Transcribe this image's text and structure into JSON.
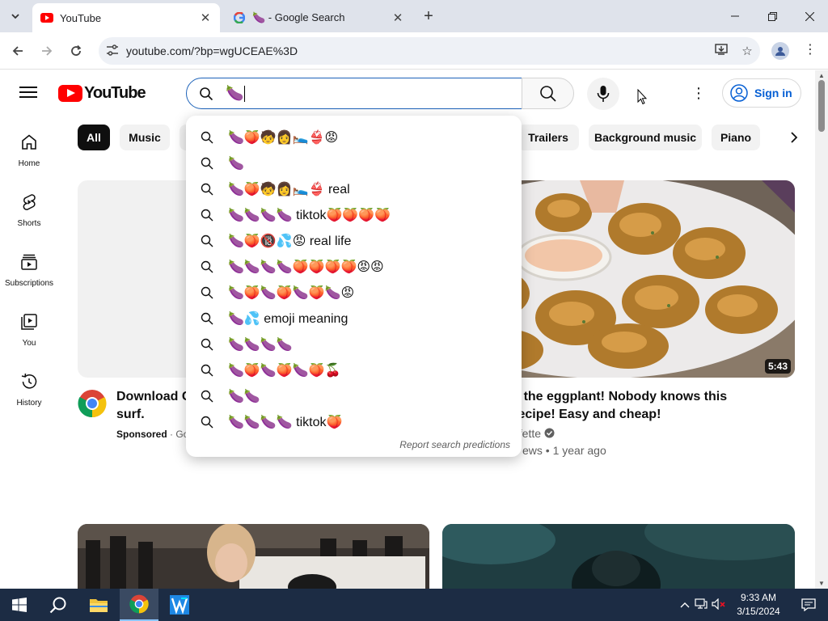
{
  "browser": {
    "tabs": [
      {
        "title": "YouTube",
        "active": true
      },
      {
        "title": "🍆 - Google Search",
        "active": false
      }
    ],
    "url": "youtube.com/?bp=wgUCEAE%3D"
  },
  "header": {
    "logo_text": "YouTube",
    "search_value": "🍆",
    "signin_label": "Sign in"
  },
  "guide": [
    {
      "label": "Home",
      "icon": "home-icon"
    },
    {
      "label": "Shorts",
      "icon": "shorts-icon"
    },
    {
      "label": "Subscriptions",
      "icon": "subscriptions-icon"
    },
    {
      "label": "You",
      "icon": "you-icon"
    },
    {
      "label": "History",
      "icon": "history-icon"
    }
  ],
  "chips": [
    "All",
    "Music",
    "Trailers",
    "Background music",
    "Piano"
  ],
  "suggestions": [
    "🍆🍑🧒👩🛌👙😡",
    "🍆",
    "🍆🍑🧒👩🛌👙 real",
    "🍆🍆🍆🍆 tiktok🍑🍑🍑🍑",
    "🍆🍑🔞💦😡 real life",
    "🍆🍆🍆🍆🍑🍑🍑🍑😡😡",
    "🍆🍑🍆🍑🍆🍑🍆😡",
    "🍆💦 emoji meaning",
    "🍆🍆🍆🍆",
    "🍆🍑🍆🍑🍆🍑🍒",
    "🍆🍆",
    "🍆🍆🍆🍆 tiktok🍑"
  ],
  "report_label": "Report search predictions",
  "videos": [
    {
      "title_line1": "Download C",
      "title_line2": "surf.",
      "sponsored": "Sponsored",
      "sponsor_suffix": "· Go"
    },
    {
      "title_line1": "ate the eggplant! Nobody knows this",
      "title_line2": "g recipe! Easy and cheap!",
      "channel": "Perfette",
      "meta": "ews • 1 year ago",
      "duration": "5:43"
    }
  ],
  "taskbar": {
    "time": "9:33 AM",
    "date": "3/15/2024"
  },
  "colors": {
    "youtube_red": "#ff0000",
    "link_blue": "#065fd4",
    "focus_blue": "#1c62b9",
    "taskbar": "#1c2c44"
  }
}
